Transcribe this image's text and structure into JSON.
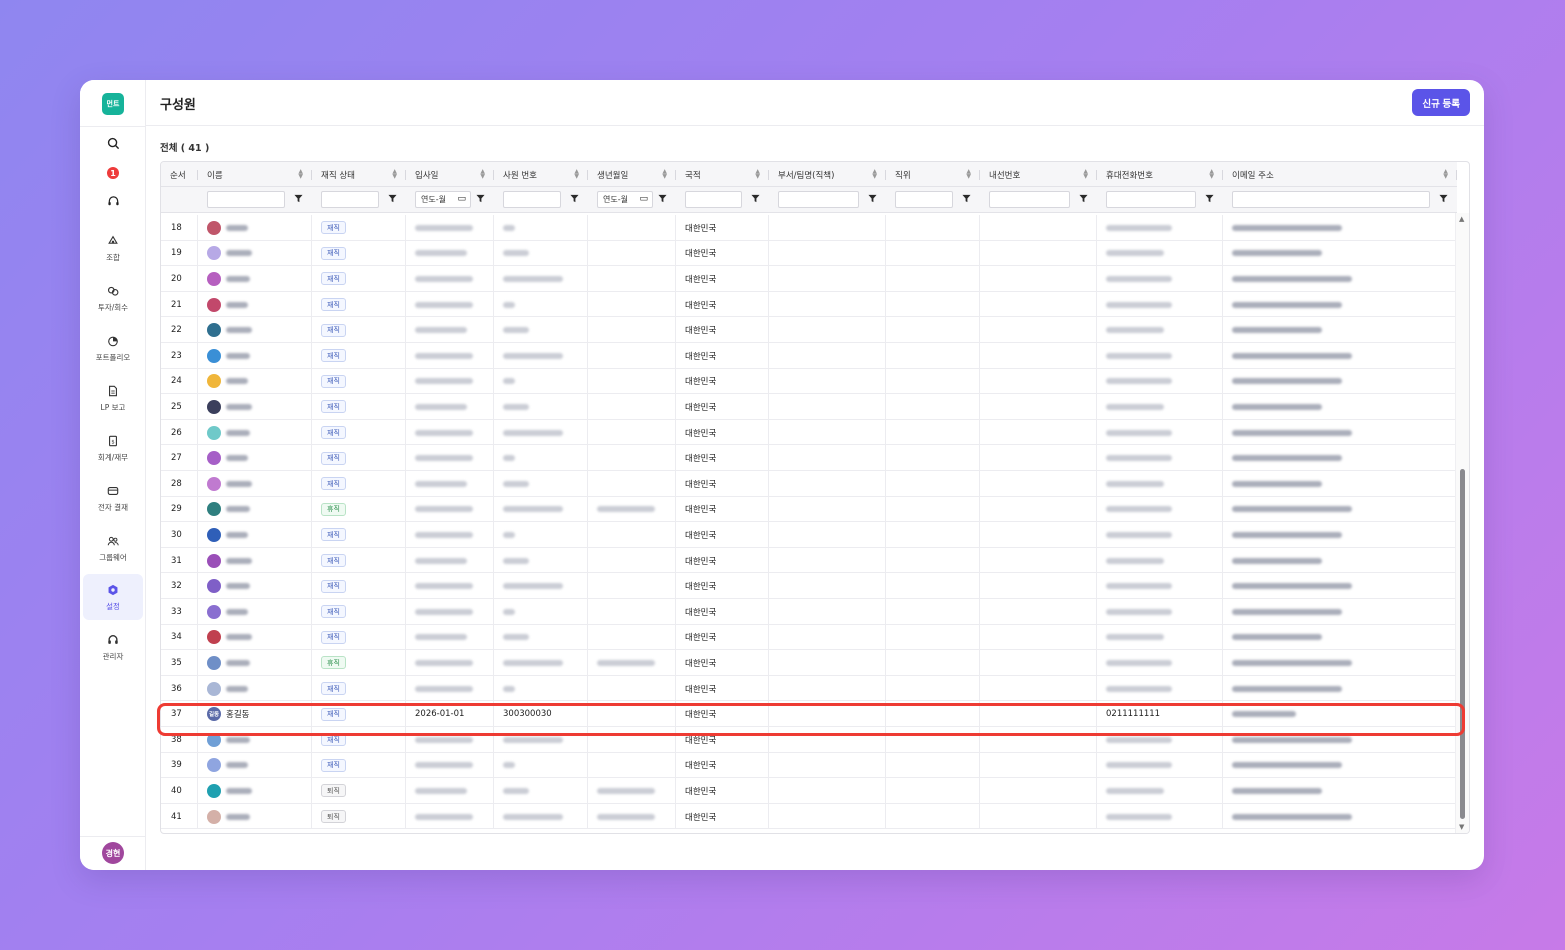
{
  "app": {
    "logo_text": "먼트",
    "page_title": "구성원",
    "new_button": "신규 등록",
    "total_label": "전체 ( 41 )",
    "notification_count": "1",
    "user_avatar": "경현"
  },
  "nav": [
    {
      "id": "combo",
      "label": "조합",
      "icon": "combination-icon"
    },
    {
      "id": "invest",
      "label": "투자/회수",
      "icon": "investment-icon"
    },
    {
      "id": "portfolio",
      "label": "포트폴리오",
      "icon": "pie-chart-icon"
    },
    {
      "id": "lp",
      "label": "LP 보고",
      "icon": "document-icon"
    },
    {
      "id": "accounting",
      "label": "회계/재무",
      "icon": "accounting-icon"
    },
    {
      "id": "approval",
      "label": "전자 결재",
      "icon": "approval-icon"
    },
    {
      "id": "groupware",
      "label": "그룹웨어",
      "icon": "people-icon"
    },
    {
      "id": "settings",
      "label": "설정",
      "icon": "settings-icon",
      "active": true
    },
    {
      "id": "admin",
      "label": "관리자",
      "icon": "admin-icon"
    }
  ],
  "table": {
    "columns": [
      "순서",
      "이름",
      "재직 상태",
      "입사일",
      "사원 번호",
      "생년월일",
      "국적",
      "부서/팀명(직책)",
      "직위",
      "내선번호",
      "휴대전화번호",
      "이메일 주소"
    ],
    "filters": {
      "date_placeholder": "연도-월"
    },
    "rows": [
      {
        "seq": "18",
        "status": "재직",
        "nationality": "대한민국",
        "color": "#c0566a"
      },
      {
        "seq": "19",
        "status": "재직",
        "nationality": "대한민국",
        "color": "#b7a9e6"
      },
      {
        "seq": "20",
        "status": "재직",
        "nationality": "대한민국",
        "color": "#b65fbf"
      },
      {
        "seq": "21",
        "status": "재직",
        "nationality": "대한민국",
        "color": "#c2486b"
      },
      {
        "seq": "22",
        "status": "재직",
        "nationality": "대한민국",
        "color": "#2f6f8f"
      },
      {
        "seq": "23",
        "status": "재직",
        "nationality": "대한민국",
        "color": "#3a8fd6"
      },
      {
        "seq": "24",
        "status": "재직",
        "nationality": "대한민국",
        "color": "#f0b63a"
      },
      {
        "seq": "25",
        "status": "재직",
        "nationality": "대한민국",
        "color": "#3b3f5c"
      },
      {
        "seq": "26",
        "status": "재직",
        "nationality": "대한민국",
        "color": "#6fc9c9"
      },
      {
        "seq": "27",
        "status": "재직",
        "nationality": "대한민국",
        "color": "#a65fc7"
      },
      {
        "seq": "28",
        "status": "재직",
        "nationality": "대한민국",
        "color": "#c07ad0"
      },
      {
        "seq": "29",
        "status": "휴직",
        "nationality": "대한민국",
        "color": "#2f7f7f"
      },
      {
        "seq": "30",
        "status": "재직",
        "nationality": "대한민국",
        "color": "#2f5fb8"
      },
      {
        "seq": "31",
        "status": "재직",
        "nationality": "대한민국",
        "color": "#9a4fb8"
      },
      {
        "seq": "32",
        "status": "재직",
        "nationality": "대한민국",
        "color": "#7f5fc7"
      },
      {
        "seq": "33",
        "status": "재직",
        "nationality": "대한민국",
        "color": "#8a6fd0"
      },
      {
        "seq": "34",
        "status": "재직",
        "nationality": "대한민국",
        "color": "#c0404f"
      },
      {
        "seq": "35",
        "status": "휴직",
        "nationality": "대한민국",
        "color": "#6f8fc7"
      },
      {
        "seq": "36",
        "status": "재직",
        "nationality": "대한민국",
        "color": "#a9b7d6"
      },
      {
        "seq": "37",
        "name": "홍길동",
        "avatar": "길동",
        "status": "재직",
        "join_date": "2026-01-01",
        "emp_no": "300300030",
        "nationality": "대한민국",
        "mobile": "0211111111",
        "color": "#5a6aa8",
        "highlight": true
      },
      {
        "seq": "38",
        "status": "재직",
        "nationality": "대한민국",
        "color": "#6f9fd6"
      },
      {
        "seq": "39",
        "status": "재직",
        "nationality": "대한민국",
        "color": "#8fa5e0"
      },
      {
        "seq": "40",
        "status": "퇴직",
        "nationality": "대한민국",
        "color": "#1fa0b0"
      },
      {
        "seq": "41",
        "status": "퇴직",
        "nationality": "대한민국",
        "color": "#d4b0a8"
      }
    ]
  }
}
